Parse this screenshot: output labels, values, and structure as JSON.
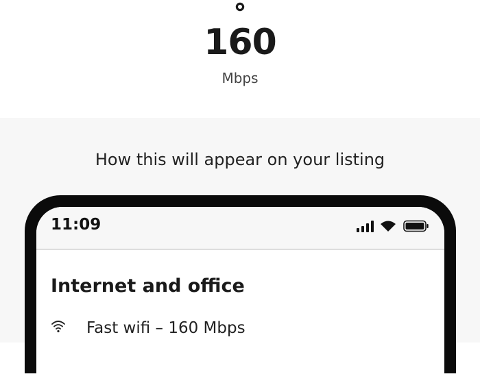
{
  "speed": {
    "icon": "wifi-icon",
    "value": "160",
    "unit": "Mbps"
  },
  "preview": {
    "heading": "How this will appear on your listing",
    "phone": {
      "status_bar": {
        "time": "11:09",
        "icons": [
          "signal-icon",
          "wifi-icon",
          "battery-icon"
        ]
      },
      "section_title": "Internet and office",
      "amenities": [
        {
          "icon": "wifi-icon",
          "label": "Fast wifi – 160 Mbps"
        }
      ]
    }
  },
  "colors": {
    "top_background": "#ffffff",
    "bottom_background": "#f7f7f7",
    "phone_frame": "#0b0b0b",
    "text": "#222222"
  }
}
